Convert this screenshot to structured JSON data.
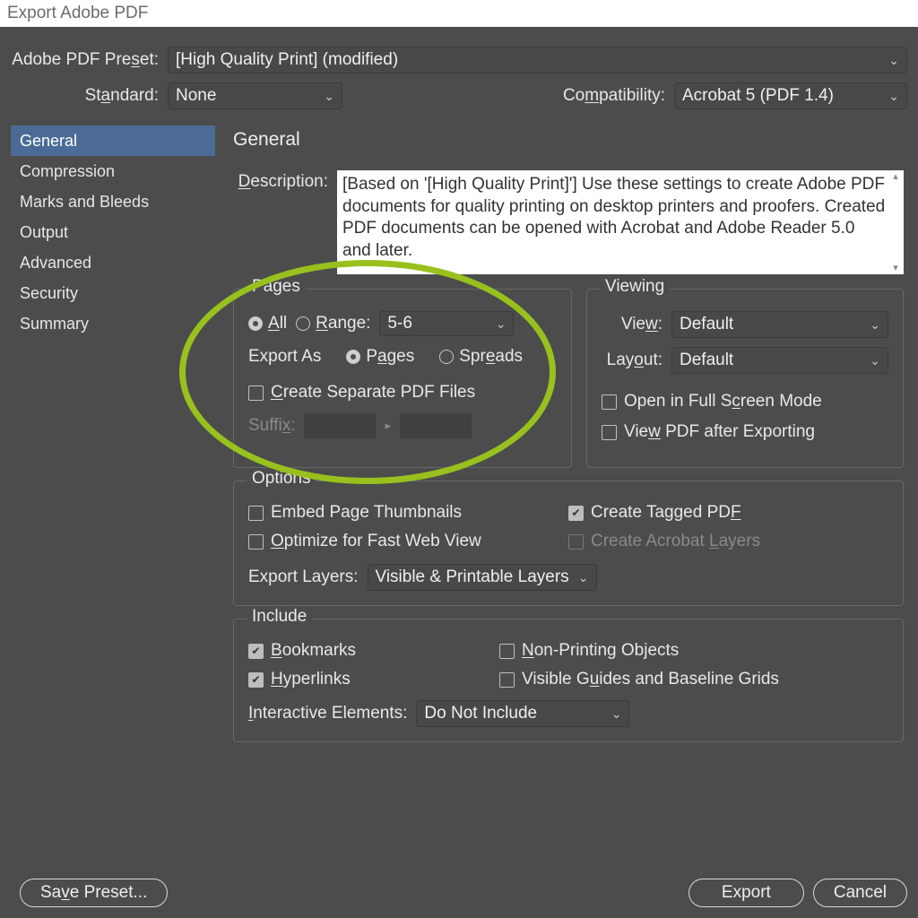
{
  "window": {
    "title": "Export Adobe PDF"
  },
  "header": {
    "preset_label": "Adobe PDF Preset:",
    "preset_value": "[High Quality Print] (modified)",
    "standard_label": "Standard:",
    "standard_value": "None",
    "compat_label": "Compatibility:",
    "compat_value": "Acrobat 5 (PDF 1.4)"
  },
  "sidebar": {
    "items": [
      "General",
      "Compression",
      "Marks and Bleeds",
      "Output",
      "Advanced",
      "Security",
      "Summary"
    ],
    "selected_index": 0
  },
  "pane": {
    "title": "General",
    "description_label": "Description:",
    "description_text": "[Based on '[High Quality Print]'] Use these settings to create Adobe PDF documents for quality printing on desktop printers and proofers.  Created PDF documents can be opened with Acrobat and Adobe Reader 5.0 and later."
  },
  "pages": {
    "legend": "Pages",
    "all": "All",
    "range": "Range:",
    "range_value": "5-6",
    "export_as": "Export As",
    "pages_rb": "Pages",
    "spreads_rb": "Spreads",
    "create_sep": "Create Separate PDF Files",
    "suffix": "Suffix:"
  },
  "viewing": {
    "legend": "Viewing",
    "view_label": "View:",
    "view_value": "Default",
    "layout_label": "Layout:",
    "layout_value": "Default",
    "fullscreen": "Open in Full Screen Mode",
    "view_after": "View PDF after Exporting"
  },
  "options": {
    "legend": "Options",
    "embed_thumbs": "Embed Page Thumbnails",
    "optimize_web": "Optimize for Fast Web View",
    "tagged_pdf": "Create Tagged PDF",
    "acro_layers": "Create Acrobat Layers",
    "export_layers_label": "Export Layers:",
    "export_layers_value": "Visible & Printable Layers"
  },
  "include": {
    "legend": "Include",
    "bookmarks": "Bookmarks",
    "hyperlinks": "Hyperlinks",
    "nonprinting": "Non-Printing Objects",
    "guides": "Visible Guides and Baseline Grids",
    "interactive_label": "Interactive Elements:",
    "interactive_value": "Do Not Include"
  },
  "footer": {
    "save_preset": "Save Preset...",
    "export": "Export",
    "cancel": "Cancel"
  }
}
